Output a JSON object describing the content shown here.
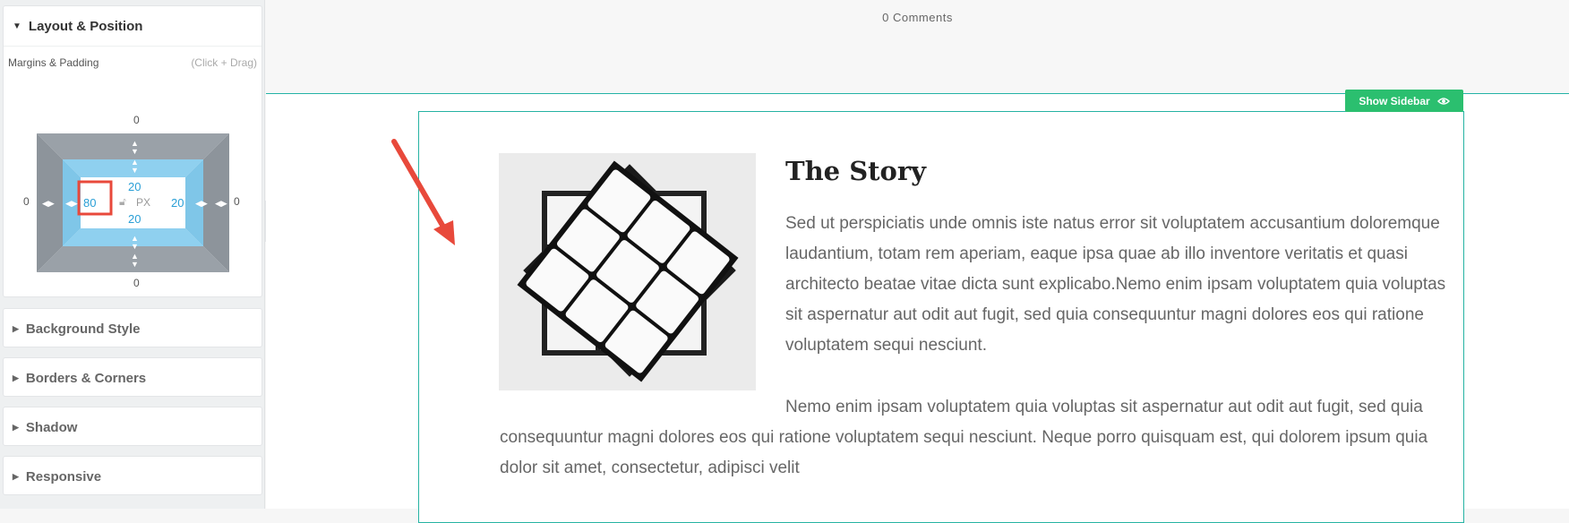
{
  "sidebar": {
    "layout_panel": {
      "title": "Layout & Position",
      "margins_label": "Margins & Padding",
      "margins_hint": "(Click + Drag)",
      "margin": {
        "top": "0",
        "right": "0",
        "bottom": "0",
        "left": "0"
      },
      "padding": {
        "top": "20",
        "right": "20",
        "bottom": "20",
        "left": "80"
      },
      "unit": "PX"
    },
    "collapsed_panels": [
      {
        "title": "Background Style"
      },
      {
        "title": "Borders & Corners"
      },
      {
        "title": "Shadow"
      },
      {
        "title": "Responsive"
      }
    ]
  },
  "canvas": {
    "comments": "0 Comments",
    "show_sidebar_label": "Show Sidebar",
    "story": {
      "title": "The Story",
      "paragraph1": "Sed ut perspiciatis unde omnis iste natus error sit voluptatem accusantium doloremque laudantium, totam rem aperiam, eaque ipsa quae ab illo inventore veritatis et quasi architecto beatae vitae dicta sunt explicabo.Nemo enim ipsam voluptatem quia voluptas sit aspernatur aut odit aut fugit, sed quia consequuntur magni dolores eos qui ratione voluptatem sequi nesciunt.",
      "paragraph2": "Nemo enim ipsam voluptatem quia voluptas sit aspernatur aut odit aut fugit, sed quia consequuntur magni dolores eos qui ratione voluptatem sequi nesciunt. Neque porro quisquam est, qui dolorem ipsum quia dolor sit amet, consectetur, adipisci velit"
    }
  },
  "colors": {
    "accent_teal": "#26b3a3",
    "show_sidebar_green": "#2bbf6f",
    "padding_blue": "#8fd0ef",
    "margin_gray": "#9aa1a8",
    "annotation_red": "#e8493b"
  },
  "icons": {
    "panel_expanded": "caret-down-icon",
    "panel_collapsed": "caret-right-icon",
    "lock": "lock-icon",
    "eye": "eye-icon",
    "sidebar_toggle": "chevron-left-icon"
  }
}
